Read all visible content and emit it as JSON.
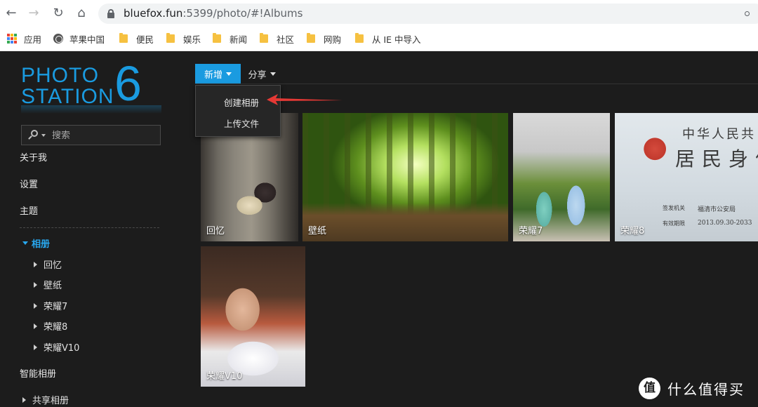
{
  "browser": {
    "nav": {
      "back": "←",
      "forward": "→",
      "reload": "↻",
      "home": "⌂"
    },
    "url_host": "bluefox.fun",
    "url_path": ":5399/photo/#!Albums",
    "bookmarks": [
      {
        "label": "应用",
        "icon": "apps-grid-icon"
      },
      {
        "label": "苹果中国",
        "icon": "globe-icon"
      },
      {
        "label": "便民",
        "icon": "folder-icon"
      },
      {
        "label": "娱乐",
        "icon": "folder-icon"
      },
      {
        "label": "新闻",
        "icon": "folder-icon"
      },
      {
        "label": "社区",
        "icon": "folder-icon"
      },
      {
        "label": "网购",
        "icon": "folder-icon"
      },
      {
        "label": "从 IE 中导入",
        "icon": "folder-icon"
      }
    ]
  },
  "logo": {
    "line1": "PHOTO",
    "line2": "STATION",
    "version": "6"
  },
  "sidebar": {
    "search_placeholder": "搜索",
    "items": [
      "关于我",
      "设置",
      "主题"
    ],
    "active_section": "相册",
    "albums": [
      "回忆",
      "壁纸",
      "荣耀7",
      "荣耀8",
      "荣耀V10"
    ],
    "smart_albums": "智能相册",
    "shared_albums": "共享相册"
  },
  "toolbar": {
    "new_label": "新增",
    "share_label": "分享"
  },
  "dropdown": {
    "create_album": "创建相册",
    "upload_files": "上传文件"
  },
  "albums_grid": [
    {
      "label": "回忆"
    },
    {
      "label": "壁纸"
    },
    {
      "label": "荣耀7"
    },
    {
      "label": "荣耀8"
    },
    {
      "label": "荣耀V10"
    }
  ],
  "id_card_text": {
    "title_top": "中华人民共",
    "title_main": "居民身份",
    "issuer_label": "签发机关",
    "issuer_value": "福清市公安局",
    "valid_label": "有效期限",
    "valid_value": "2013.09.30-2033"
  },
  "watermark": {
    "glyph": "值",
    "text": "什么值得买"
  },
  "colors": {
    "accent": "#1a9be0",
    "active_text": "#29a8ef",
    "sidebar_bg": "#1c1c1c",
    "arrow": "#e53935"
  }
}
